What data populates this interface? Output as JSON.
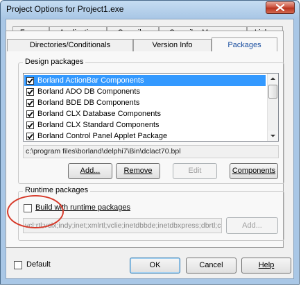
{
  "window": {
    "title": "Project Options for Project1.exe"
  },
  "tabs_top": [
    {
      "label": "Forms"
    },
    {
      "label": "Application"
    },
    {
      "label": "Compiler"
    },
    {
      "label": "Compiler Messages"
    },
    {
      "label": "Linker"
    }
  ],
  "tabs_bottom": [
    {
      "label": "Directories/Conditionals"
    },
    {
      "label": "Version Info"
    },
    {
      "label": "Packages"
    }
  ],
  "design": {
    "group_label": "Design packages",
    "items": [
      {
        "label": "Borland ActionBar Components",
        "checked": true,
        "selected": true
      },
      {
        "label": "Borland ADO DB Components",
        "checked": true
      },
      {
        "label": "Borland BDE DB Components",
        "checked": true
      },
      {
        "label": "Borland CLX Database Components",
        "checked": true
      },
      {
        "label": "Borland CLX Standard Components",
        "checked": true
      },
      {
        "label": "Borland Control Panel Applet Package",
        "checked": true
      }
    ],
    "path": "c:\\program files\\borland\\delphi7\\Bin\\dclact70.bpl",
    "buttons": {
      "add": "Add...",
      "remove": "Remove",
      "edit": "Edit",
      "components": "Components"
    }
  },
  "runtime": {
    "group_label": "Runtime packages",
    "checkbox_label": "Build with runtime packages",
    "packages_value": "vcl;rtl;vclx;indy;inet;xmlrtl;vclie;inetdbbde;inetdbxpress;dbrtl;c",
    "add_label": "Add..."
  },
  "footer": {
    "default_label": "Default",
    "ok_label": "OK",
    "cancel_label": "Cancel",
    "help_label": "Help"
  },
  "colors": {
    "selection": "#3399ff",
    "highlight_circle": "#d73a2a",
    "active_tab_text": "#1a4fa0"
  }
}
